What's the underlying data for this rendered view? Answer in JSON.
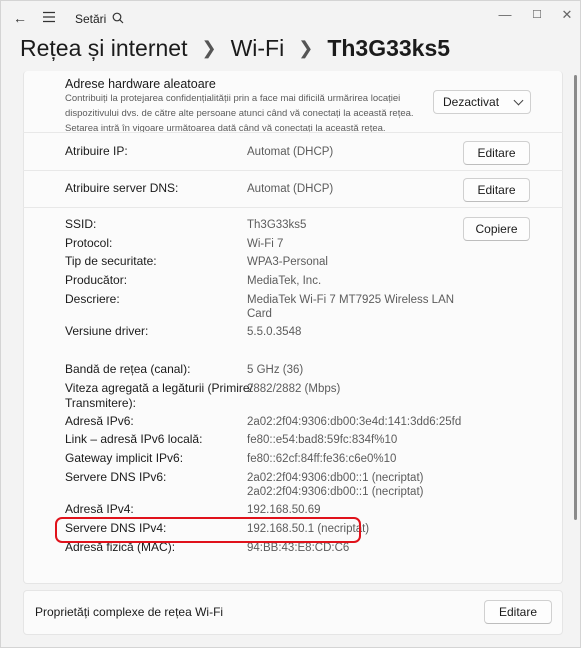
{
  "app": {
    "title": "Setări"
  },
  "breadcrumb": [
    "Rețea și internet",
    "Wi-Fi",
    "Th3G33ks5"
  ],
  "hardware": {
    "title": "Adrese hardware aleatoare",
    "desc_lines": [
      "Contribuiți la protejarea confidențialității prin a face mai dificilă urmărirea locației",
      "dispozitivului dvs. de către alte persoane atunci când vă conectați la această rețea.",
      "Setarea intră în vigoare următoarea dată când vă conectați la această rețea."
    ],
    "dropdown_value": "Dezactivat"
  },
  "ip_assignment": {
    "label": "Atribuire IP:",
    "value": "Automat (DHCP)",
    "button": "Editare"
  },
  "dns_assignment": {
    "label": "Atribuire server DNS:",
    "value": "Automat (DHCP)",
    "button": "Editare"
  },
  "copy_button": "Copiere",
  "props": [
    {
      "label": "SSID:",
      "value": "Th3G33ks5"
    },
    {
      "label": "Protocol:",
      "value": "Wi-Fi 7"
    },
    {
      "label": "Tip de securitate:",
      "value": "WPA3-Personal"
    },
    {
      "label": "Producător:",
      "value": "MediaTek, Inc."
    },
    {
      "label": "Descriere:",
      "value": "MediaTek Wi-Fi 7 MT7925 Wireless LAN",
      "value2": "Card"
    },
    {
      "label": "Versiune driver:",
      "value": "5.5.0.3548"
    },
    {
      "label": "Bandă de rețea (canal):",
      "value": "5 GHz (36)"
    },
    {
      "label": "Viteza agregată a legăturii (Primire/",
      "label2": "Transmitere):",
      "value": "2882/2882 (Mbps)"
    },
    {
      "label": "Adresă IPv6:",
      "value": "2a02:2f04:9306:db00:3e4d:141:3dd6:25fd"
    },
    {
      "label": "Link – adresă IPv6 locală:",
      "value": "fe80::e54:bad8:59fc:834f%10"
    },
    {
      "label": "Gateway implicit IPv6:",
      "value": "fe80::62cf:84ff:fe36:c6e0%10"
    },
    {
      "label": "Servere DNS IPv6:",
      "value": "2a02:2f04:9306:db00::1 (necriptat)",
      "value2": "2a02:2f04:9306:db00::1 (necriptat)"
    },
    {
      "label": "Adresă IPv4:",
      "value": "192.168.50.69"
    },
    {
      "label": "Servere DNS IPv4:",
      "value": "192.168.50.1 (necriptat)"
    },
    {
      "label": "Adresă fizică (MAC):",
      "value": "94:BB:43:E8:CD:C6"
    }
  ],
  "advanced": {
    "label": "Proprietăți complexe de rețea Wi-Fi",
    "button": "Editare"
  }
}
